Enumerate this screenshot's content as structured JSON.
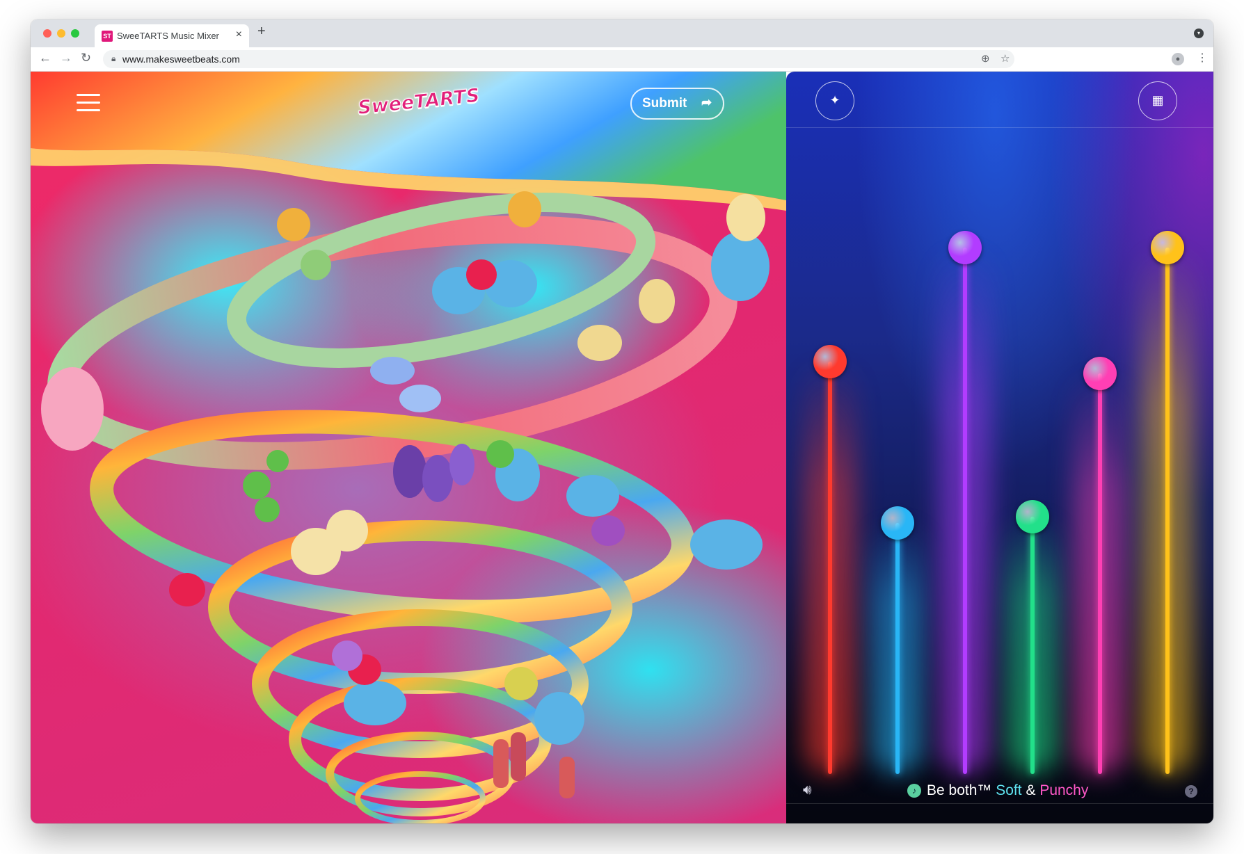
{
  "browser": {
    "tab_title": "SweeTARTS Music Mixer",
    "tab_favicon_text": "ST",
    "tab_close": "×",
    "new_tab": "+",
    "url": "www.makesweetbeats.com",
    "icons": [
      "back-icon",
      "forward-icon",
      "reload-icon",
      "lock-icon",
      "zoom-icon",
      "bookmark-star-icon",
      "profile-icon",
      "kebab-menu-icon"
    ]
  },
  "site": {
    "logo_text": "SweeTARTS",
    "submit_label": "Submit",
    "menu_icon": "hamburger-icon"
  },
  "mixer": {
    "left_button_icon": "sparkle-icon",
    "right_button_icon": "grid-icon",
    "tagline": {
      "prefix": "Be both™",
      "soft": "Soft",
      "amp": "&",
      "punchy": "Punchy"
    },
    "colors": {
      "soft": "#5fe3f0",
      "punchy": "#ff58c8"
    },
    "sliders": [
      {
        "name": "red-rope",
        "color": "#ff3a2e",
        "level": 0.69
      },
      {
        "name": "blue-rope",
        "color": "#29b6f6",
        "level": 0.42
      },
      {
        "name": "purple-tart",
        "color": "#b23cff",
        "level": 0.88
      },
      {
        "name": "green-gummies",
        "color": "#22e08a",
        "level": 0.43
      },
      {
        "name": "pink-tart",
        "color": "#ff3fb4",
        "level": 0.67
      },
      {
        "name": "yellow-tart",
        "color": "#ffc21a",
        "level": 0.88
      }
    ]
  }
}
